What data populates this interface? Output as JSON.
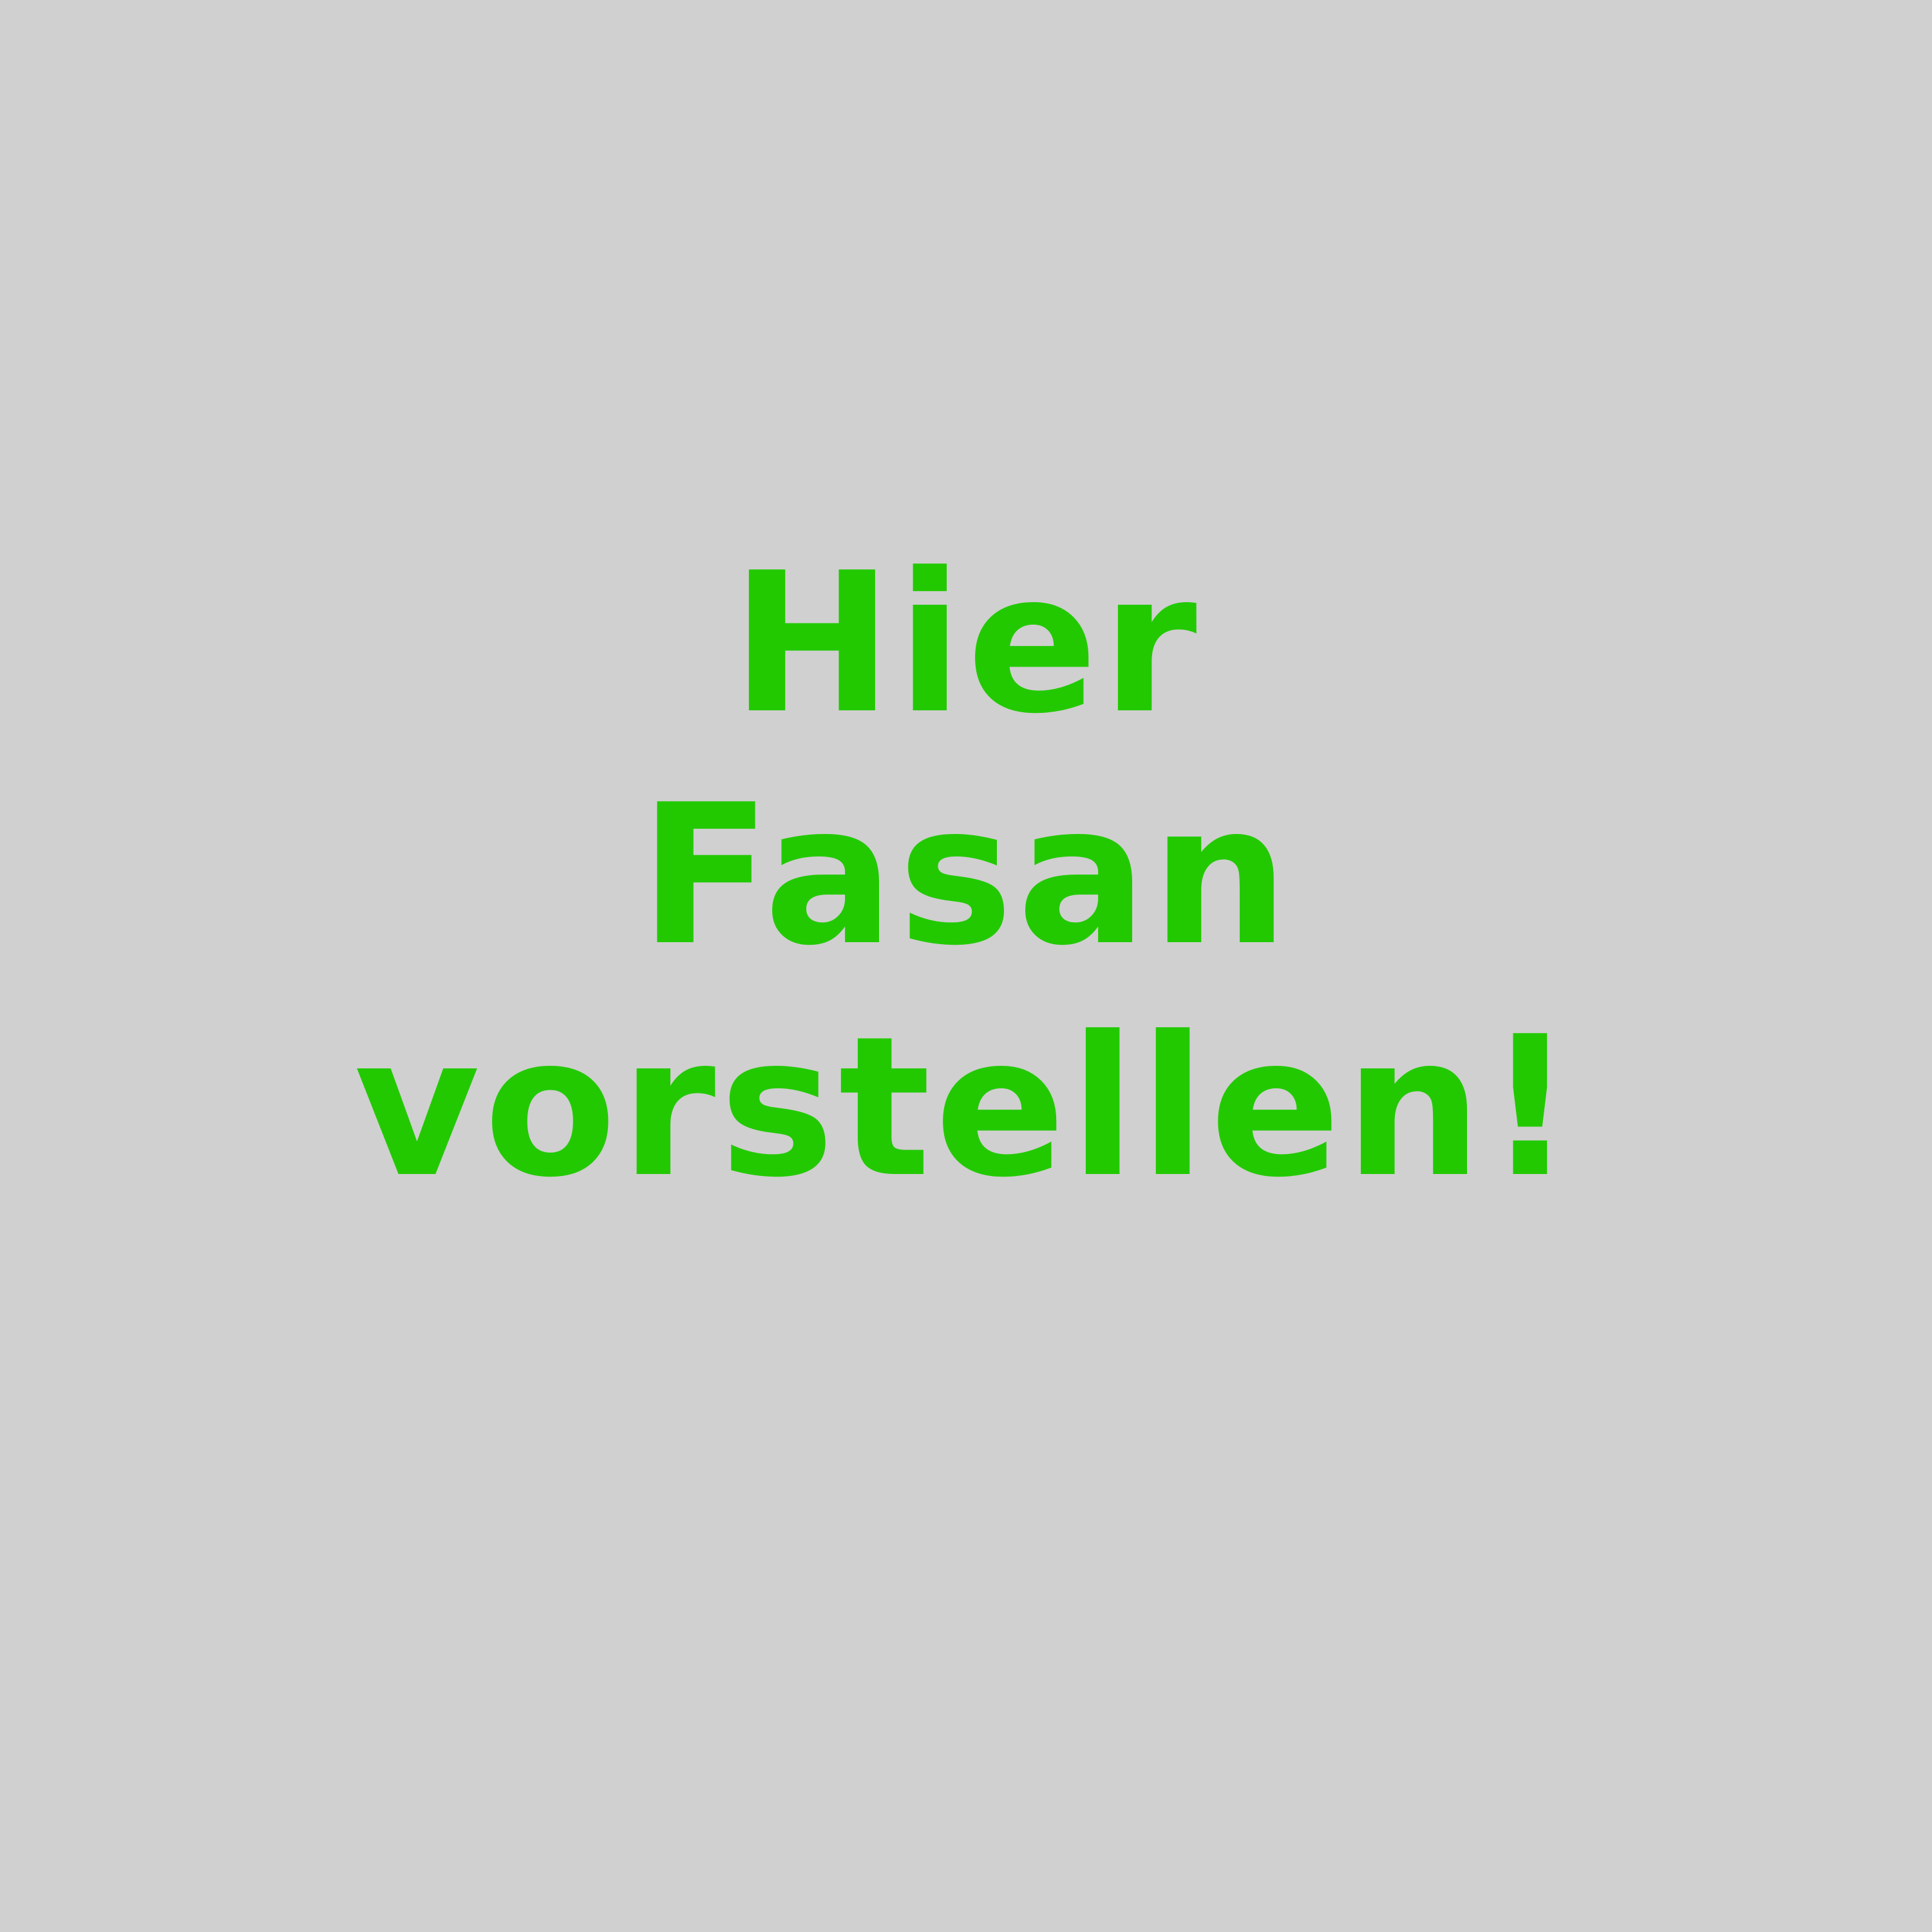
{
  "background_color": "#D0D0D0",
  "text_color": "#22C900",
  "headline": {
    "lines": [
      "Hier",
      "Fasan",
      "vorstellen!"
    ]
  }
}
